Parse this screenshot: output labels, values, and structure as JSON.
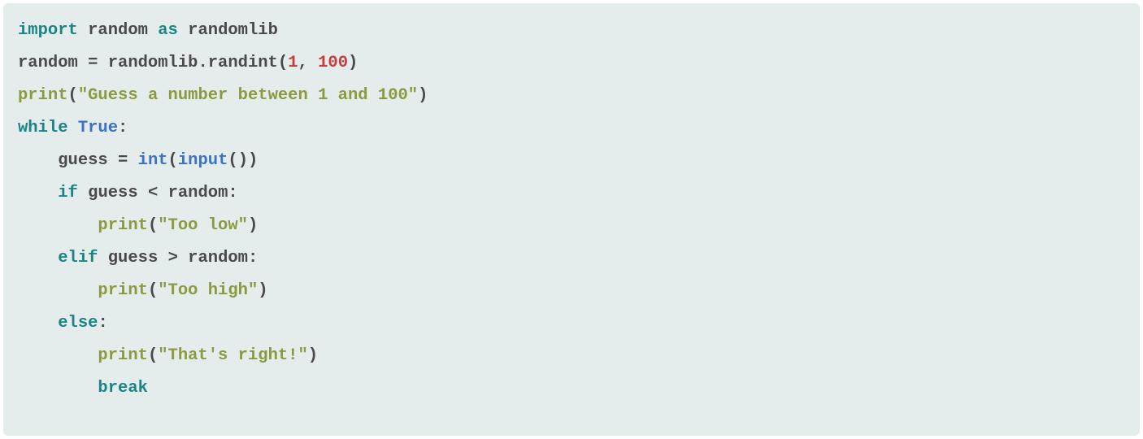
{
  "code": {
    "line1": {
      "import": "import",
      "random": "random",
      "as": "as",
      "randomlib": "randomlib"
    },
    "line2": {
      "random": "random",
      "eq": " = ",
      "randomlib": "randomlib",
      "dot": ".",
      "randint": "randint",
      "lparen": "(",
      "one": "1",
      "comma": ", ",
      "hundred": "100",
      "rparen": ")"
    },
    "line3": {
      "print": "print",
      "lparen": "(",
      "str": "\"Guess a number between 1 and 100\"",
      "rparen": ")"
    },
    "line4": {
      "while": "while",
      "sp": " ",
      "true": "True",
      "colon": ":"
    },
    "line5": {
      "indent": "    ",
      "guess": "guess",
      "eq": " = ",
      "int": "int",
      "lparen1": "(",
      "input": "input",
      "lparen2": "(",
      "rparen2": ")",
      "rparen1": ")"
    },
    "line6": {
      "indent": "    ",
      "if": "if",
      "sp1": " ",
      "guess": "guess",
      "lt": " < ",
      "random": "random",
      "colon": ":"
    },
    "line7": {
      "indent": "        ",
      "print": "print",
      "lparen": "(",
      "str": "\"Too low\"",
      "rparen": ")"
    },
    "line8": {
      "indent": "    ",
      "elif": "elif",
      "sp1": " ",
      "guess": "guess",
      "gt": " > ",
      "random": "random",
      "colon": ":"
    },
    "line9": {
      "indent": "        ",
      "print": "print",
      "lparen": "(",
      "str": "\"Too high\"",
      "rparen": ")"
    },
    "line10": {
      "indent": "    ",
      "else": "else",
      "colon": ":"
    },
    "line11": {
      "indent": "        ",
      "print": "print",
      "lparen": "(",
      "str": "\"That's right!\"",
      "rparen": ")"
    },
    "line12": {
      "indent": "        ",
      "break": "break"
    }
  }
}
